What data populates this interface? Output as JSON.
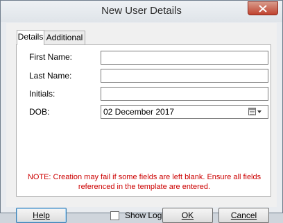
{
  "window": {
    "title": "New User Details"
  },
  "tabs": [
    "Details",
    "Additional"
  ],
  "form": {
    "first_name_label": "First Name:",
    "last_name_label": "Last Name:",
    "initials_label": "Initials:",
    "dob_label": "DOB:",
    "first_name_value": "",
    "last_name_value": "",
    "initials_value": "",
    "dob_value": "02 December 2017"
  },
  "note": {
    "line1": "NOTE: Creation may fail if some fields are left blank. Ensure all fields",
    "line2": "referenced in the template are entered."
  },
  "footer": {
    "help_label": "Help",
    "show_log_label": "Show Log",
    "show_log_checked": false,
    "ok_label": "OK",
    "cancel_label": "Cancel"
  },
  "colors": {
    "note": "#cc0000",
    "close_button": "#c0432f"
  }
}
